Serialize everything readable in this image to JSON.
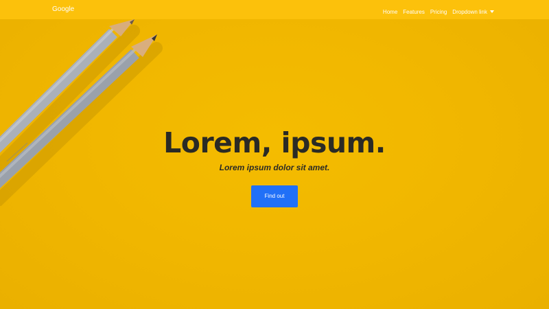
{
  "navbar": {
    "brand": "Google",
    "links": [
      "Home",
      "Features",
      "Pricing",
      "Dropdown link"
    ]
  },
  "hero": {
    "title": "Lorem, ipsum.",
    "subtitle": "Lorem ipsum dolor sit amet.",
    "button_label": "Find out"
  },
  "colors": {
    "background": "#f1b700",
    "navbar": "#fcc10b",
    "button": "#2170f7",
    "heading": "#2a2a25"
  },
  "icons": [
    "dropdown-caret-icon",
    "pencil-icon"
  ]
}
